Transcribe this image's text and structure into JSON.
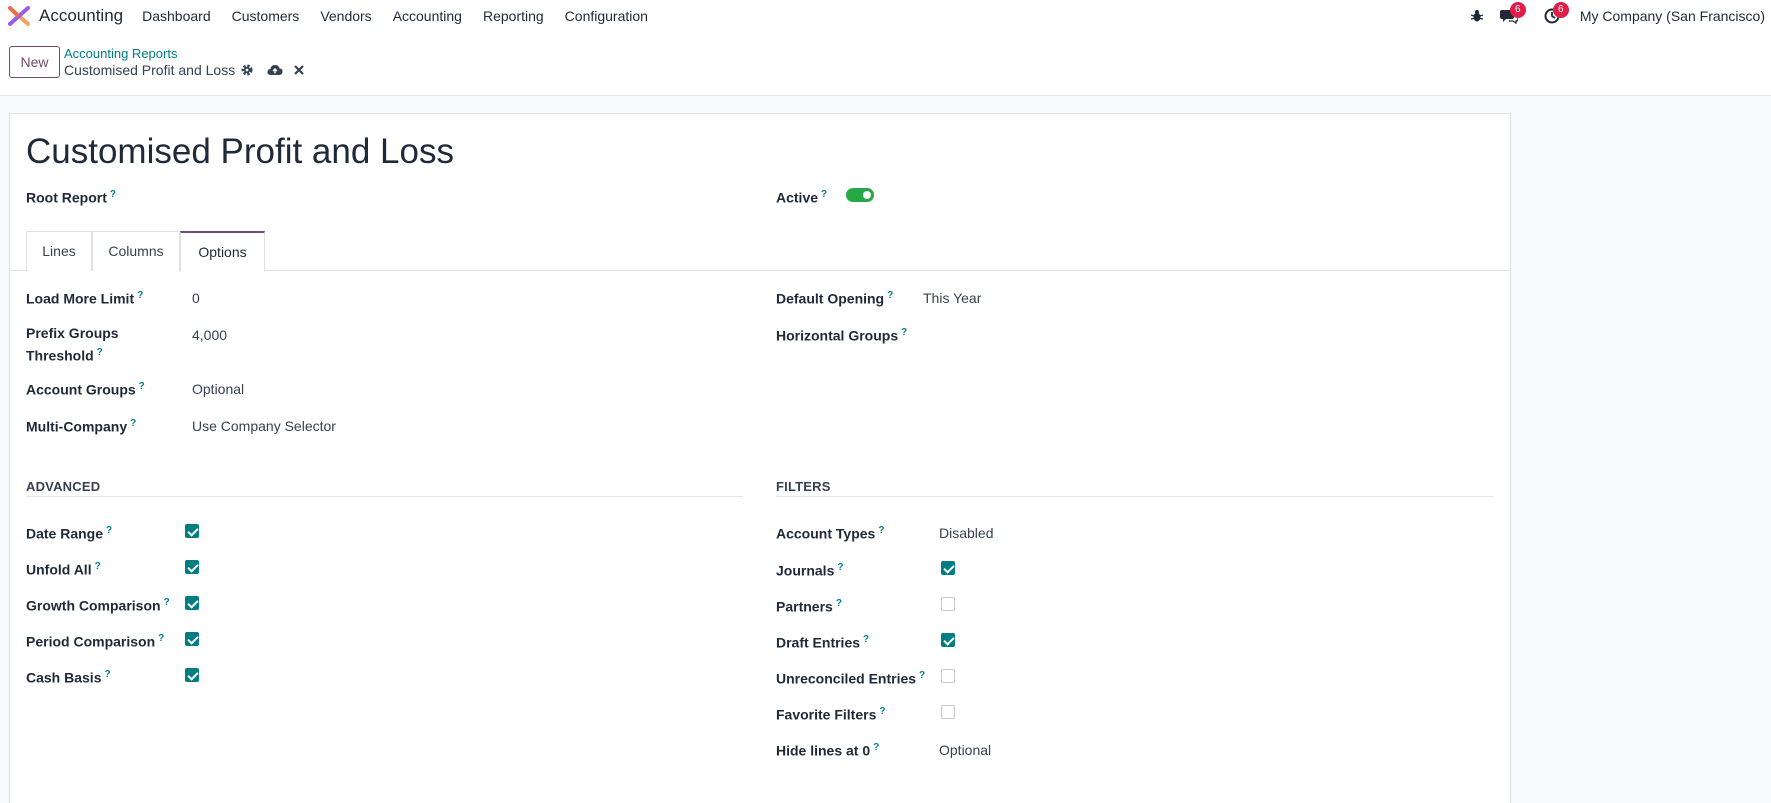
{
  "nav": {
    "app_name": "Accounting",
    "menu": [
      "Dashboard",
      "Customers",
      "Vendors",
      "Accounting",
      "Reporting",
      "Configuration"
    ],
    "messages_count": "6",
    "activities_count": "6",
    "company": "My Company (San Francisco)"
  },
  "control_panel": {
    "new_label": "New",
    "breadcrumb_parent": "Accounting Reports",
    "breadcrumb_current": "Customised Profit and Loss"
  },
  "form": {
    "title": "Customised Profit and Loss",
    "root_report_label": "Root Report",
    "active_label": "Active",
    "active": true,
    "tabs": [
      "Lines",
      "Columns",
      "Options"
    ],
    "active_tab": "Options",
    "help_mark": "?",
    "options_left": [
      {
        "label": "Load More Limit",
        "value": "0"
      },
      {
        "label": "Prefix Groups Threshold",
        "value": "4,000"
      },
      {
        "label": "Account Groups",
        "value": "Optional"
      },
      {
        "label": "Multi-Company",
        "value": "Use Company Selector"
      }
    ],
    "options_right": [
      {
        "label": "Default Opening",
        "value": "This Year"
      },
      {
        "label": "Horizontal Groups",
        "value": ""
      }
    ],
    "advanced": {
      "title": "ADVANCED",
      "items": [
        {
          "label": "Date Range",
          "checked": true
        },
        {
          "label": "Unfold All",
          "checked": true
        },
        {
          "label": "Growth Comparison",
          "checked": true
        },
        {
          "label": "Period Comparison",
          "checked": true
        },
        {
          "label": "Cash Basis",
          "checked": true
        }
      ]
    },
    "filters": {
      "title": "FILTERS",
      "account_types": {
        "label": "Account Types",
        "value": "Disabled"
      },
      "journals": {
        "label": "Journals",
        "checked": true
      },
      "partners": {
        "label": "Partners",
        "checked": false
      },
      "draft_entries": {
        "label": "Draft Entries",
        "checked": true
      },
      "unreconciled_entries": {
        "label": "Unreconciled Entries",
        "checked": false
      },
      "favorite_filters": {
        "label": "Favorite Filters",
        "checked": false
      },
      "hide_lines": {
        "label": "Hide lines at 0",
        "value": "Optional"
      }
    }
  },
  "colors": {
    "brand": "#714b67",
    "accent": "#017e84",
    "toggle_on": "#28a745",
    "badge": "#e11d48"
  },
  "icons": [
    "app-logo-icon",
    "bug-icon",
    "chat-icon",
    "clock-icon",
    "gear-icon",
    "cloud-upload-icon",
    "close-icon"
  ]
}
